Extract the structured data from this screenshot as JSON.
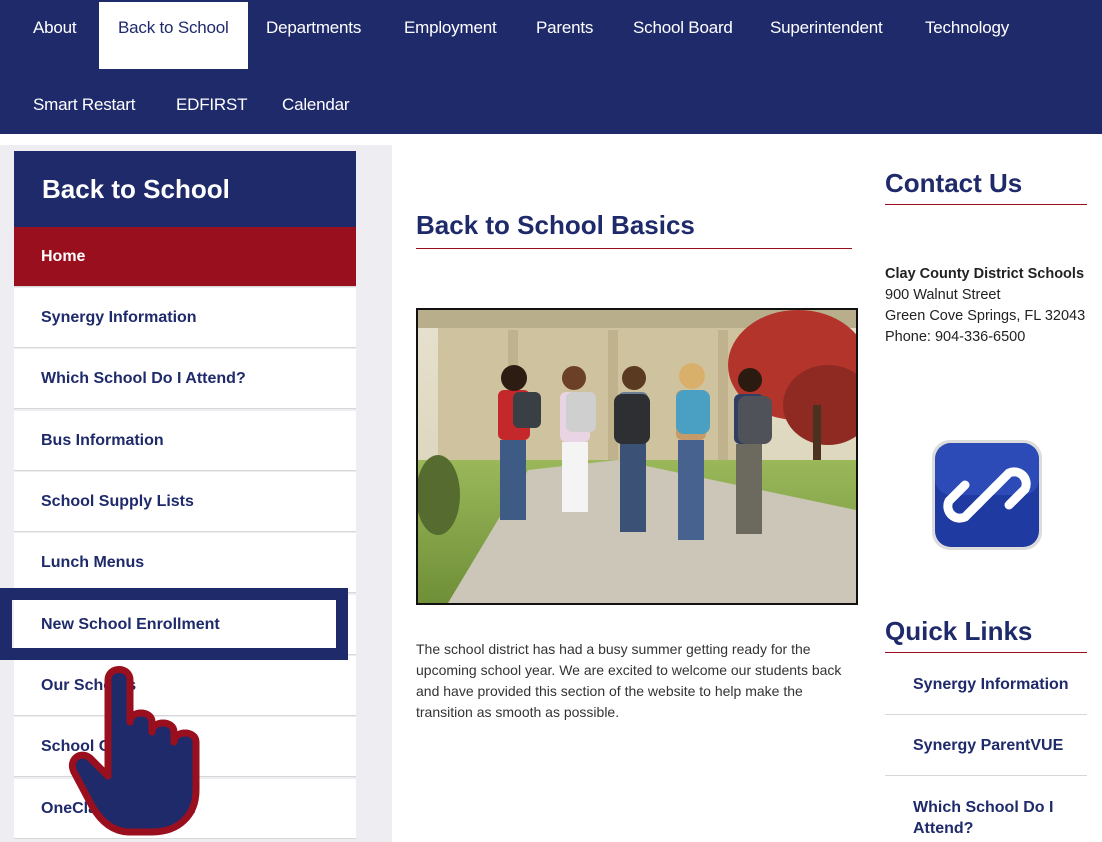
{
  "topnav": {
    "items": [
      {
        "label": "About"
      },
      {
        "label": "Back to School"
      },
      {
        "label": "Departments"
      },
      {
        "label": "Employment"
      },
      {
        "label": "Parents"
      },
      {
        "label": "School Board"
      },
      {
        "label": "Superintendent"
      },
      {
        "label": "Technology"
      },
      {
        "label": "Smart Restart"
      },
      {
        "label": "EDFIRST"
      },
      {
        "label": "Calendar"
      }
    ],
    "active": "Back to School"
  },
  "sidebar": {
    "title": "Back to School",
    "items": [
      {
        "label": "Home"
      },
      {
        "label": "Synergy Information"
      },
      {
        "label": "Which School Do I Attend?"
      },
      {
        "label": "Bus Information"
      },
      {
        "label": "School Supply Lists"
      },
      {
        "label": "Lunch Menus"
      },
      {
        "label": "New School Enrollment"
      },
      {
        "label": "Our Schools"
      },
      {
        "label": "School Calendar"
      },
      {
        "label": "OneClay Curriculum"
      }
    ],
    "selected": "Home",
    "highlighted": "New School Enrollment"
  },
  "main": {
    "title": "Back to School Basics",
    "body": "The school district has had a busy summer getting ready for the upcoming school year.  We are excited to welcome our students back and have provided this section of the website to help make the transition as smooth as possible."
  },
  "contact": {
    "heading": "Contact Us",
    "org": "Clay County District Schools",
    "street": "900 Walnut Street",
    "city": "Green Cove Springs, FL 32043",
    "phone": "Phone: 904-336-6500"
  },
  "quick_links": {
    "heading": "Quick Links",
    "items": [
      {
        "label": "Synergy Information"
      },
      {
        "label": "Synergy ParentVUE"
      },
      {
        "label": "Which School Do I Attend?"
      }
    ]
  },
  "icons": {
    "link": "chain-link-icon",
    "pointer": "pointing-hand-icon"
  },
  "colors": {
    "navy": "#1f2a6b",
    "maroon": "#9a0f1e"
  }
}
